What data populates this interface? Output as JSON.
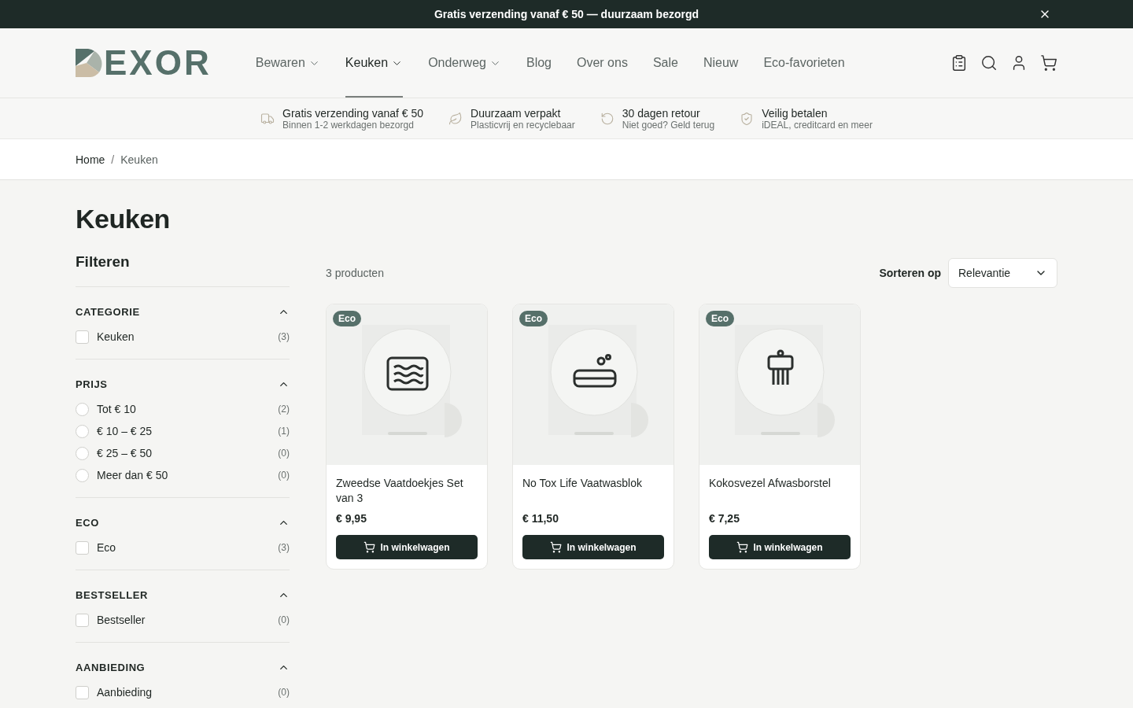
{
  "announcement": {
    "text": "Gratis verzending vanaf € 50 — duurzaam bezorgd"
  },
  "header": {
    "logo": "EXOR",
    "nav": [
      {
        "label": "Bewaren",
        "dropdown": true,
        "selected": false
      },
      {
        "label": "Keuken",
        "dropdown": true,
        "selected": true
      },
      {
        "label": "Onderweg",
        "dropdown": true,
        "selected": false
      },
      {
        "label": "Blog",
        "dropdown": false,
        "selected": false
      },
      {
        "label": "Over ons",
        "dropdown": false,
        "selected": false
      },
      {
        "label": "Sale",
        "dropdown": false,
        "selected": false
      },
      {
        "label": "Nieuw",
        "dropdown": false,
        "selected": false
      },
      {
        "label": "Eco-favorieten",
        "dropdown": false,
        "selected": false
      }
    ]
  },
  "usps": [
    {
      "kind": "truck",
      "title": "Gratis verzending vanaf € 50",
      "subtitle": "Binnen 1-2 werkdagen bezorgd"
    },
    {
      "kind": "leaf",
      "title": "Duurzaam verpakt",
      "subtitle": "Plasticvrij en recyclebaar"
    },
    {
      "kind": "return",
      "title": "30 dagen retour",
      "subtitle": "Niet goed? Geld terug"
    },
    {
      "kind": "shield",
      "title": "Veilig betalen",
      "subtitle": "iDEAL, creditcard en meer"
    }
  ],
  "breadcrumb": {
    "separator": "/",
    "items": [
      "Home",
      "Keuken"
    ]
  },
  "page_title": "Keuken",
  "filters": {
    "title": "Filteren",
    "groups": [
      {
        "title": "CATEGORIE",
        "expanded": true,
        "kind": "checkbox",
        "options": [
          {
            "label": "Keuken",
            "count": "(3)",
            "checked": false
          }
        ]
      },
      {
        "title": "PRIJS",
        "expanded": true,
        "kind": "radio",
        "options": [
          {
            "label": "Tot € 10",
            "count": "(2)",
            "checked": false
          },
          {
            "label": "€ 10 – € 25",
            "count": "(1)",
            "checked": false
          },
          {
            "label": "€ 25 – € 50",
            "count": "(0)",
            "checked": false
          },
          {
            "label": "Meer dan € 50",
            "count": "(0)",
            "checked": false
          }
        ]
      },
      {
        "title": "ECO",
        "expanded": true,
        "kind": "checkbox",
        "options": [
          {
            "label": "Eco",
            "count": "(3)",
            "checked": false
          }
        ]
      },
      {
        "title": "BESTSELLER",
        "expanded": true,
        "kind": "checkbox",
        "options": [
          {
            "label": "Bestseller",
            "count": "(0)",
            "checked": false
          }
        ]
      },
      {
        "title": "AANBIEDING",
        "expanded": true,
        "kind": "checkbox",
        "options": [
          {
            "label": "Aanbieding",
            "count": "(0)",
            "checked": false
          }
        ]
      }
    ]
  },
  "results": {
    "count": "3 producten",
    "sort_label": "Sorteren op",
    "sort_value": "Relevantie"
  },
  "products": [
    {
      "badge": "Eco",
      "kind": "cloth",
      "name": "Zweedse Vaatdoekjes Set van 3",
      "price": "€ 9,95",
      "button": "In winkelwagen"
    },
    {
      "badge": "Eco",
      "kind": "soap",
      "name": "No Tox Life Vaatwasblok",
      "price": "€ 11,50",
      "button": "In winkelwagen"
    },
    {
      "badge": "Eco",
      "kind": "brush",
      "name": "Kokosvezel Afwasborstel",
      "price": "€ 7,25",
      "button": "In winkelwagen"
    }
  ]
}
